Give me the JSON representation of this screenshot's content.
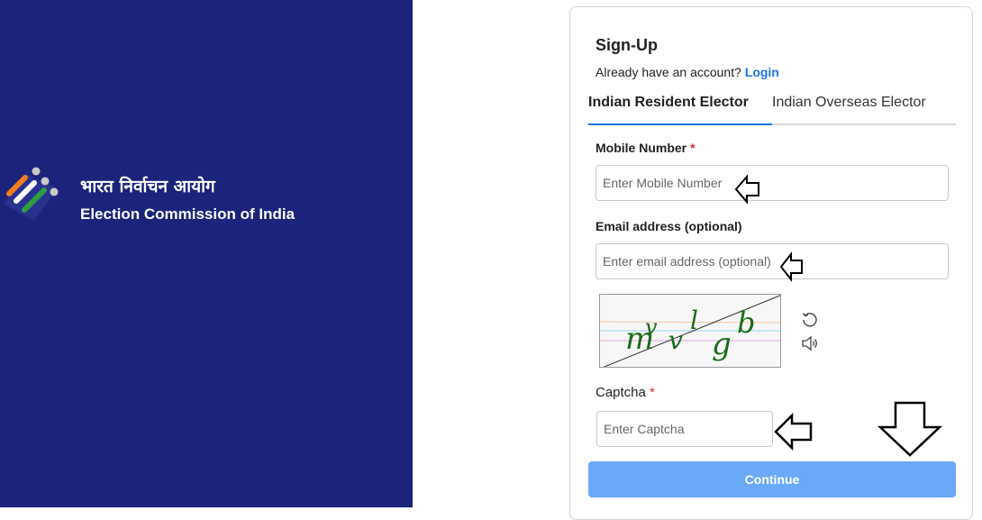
{
  "brand": {
    "hindi_name": "भारत निर्वाचन आयोग",
    "english_name": "Election Commission of India",
    "logo_icon": "eci-logo-icon"
  },
  "signup": {
    "title": "Sign-Up",
    "account_prompt": "Already have an account?",
    "login_link": "Login",
    "tabs": [
      {
        "label": "Indian Resident Elector",
        "active": true
      },
      {
        "label": "Indian Overseas Elector",
        "active": false
      }
    ],
    "mobile": {
      "label": "Mobile Number",
      "required_mark": "*",
      "placeholder": "Enter Mobile Number",
      "value": ""
    },
    "email": {
      "label": "Email address (optional)",
      "placeholder": "Enter email address (optional)",
      "value": ""
    },
    "captcha": {
      "image_text": "mvvlgb",
      "refresh_icon": "refresh-icon",
      "audio_icon": "speaker-icon",
      "label": "Captcha",
      "required_mark": "*",
      "placeholder": "Enter Captcha",
      "value": ""
    },
    "continue_button": "Continue"
  },
  "colors": {
    "sidebar_bg": "#1b247a",
    "accent": "#1a73e8",
    "button_bg": "#6aa8f8",
    "required": "#d32f2f"
  }
}
